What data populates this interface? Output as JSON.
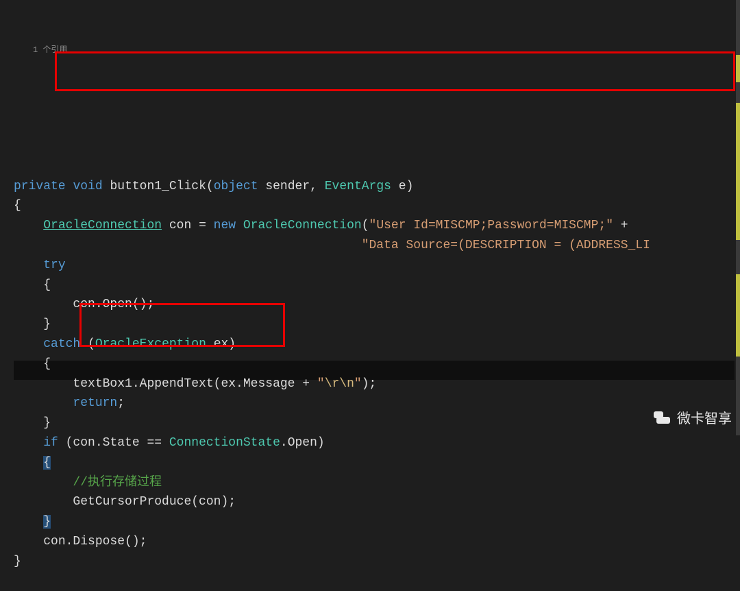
{
  "ref_hint": "1 个引用",
  "sig": {
    "private": "private",
    "void": "void",
    "name": "button1_Click",
    "obj": "object",
    "sender": " sender, ",
    "evargs": "EventArgs",
    "e": " e"
  },
  "line_conn": {
    "type1": "OracleConnection",
    "var": " con ",
    "eq": "= ",
    "new": "new",
    "type2": " OracleConnection",
    "str1": "\"User Id=MISCMP;Password=MISCMP;\"",
    "plus": " +",
    "str2": "\"Data Source=(DESCRIPTION = (ADDRESS_LI"
  },
  "try_kw": "try",
  "open_call": "con.Open();",
  "catch_kw": "catch",
  "catch_type": "OracleException",
  "catch_var": " ex",
  "append_pre": "textBox1.AppendText(ex.Message + ",
  "append_str_open": "\"",
  "append_esc": "\\r\\n",
  "append_str_close": "\"",
  "append_end": ");",
  "return_kw": "return",
  "if_kw": "if",
  "if_expr_a": " (con.State == ",
  "if_type": "ConnectionState",
  "if_dot": ".",
  "if_enum": "Open",
  "if_close": ")",
  "comment": "//执行存储过程",
  "getcur": "GetCursorProduce(con);",
  "dispose": "con.Dispose();",
  "watermark": "微卡智享"
}
